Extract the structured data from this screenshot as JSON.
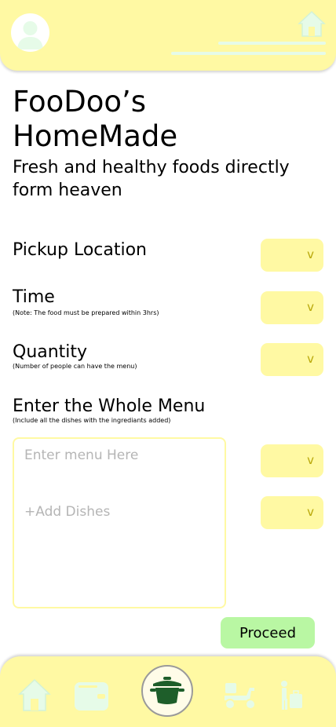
{
  "header": {
    "avatar_icon": "user-avatar-icon",
    "home_icon": "home-icon"
  },
  "title": "FooDoo’s HomeMade",
  "subtitle": "Fresh and healthy foods directly form heaven",
  "form": {
    "pickup_label": "Pickup Location",
    "time_label": "Time",
    "time_note": "(Note: The food must be prepared within 3hrs)",
    "quantity_label": "Quantity",
    "quantity_note": "(Number of people can have the menu)",
    "menu_label": "Enter the Whole Menu",
    "menu_note": "(Include all the dishes with the ingrediants added)",
    "menu_placeholder": "Enter menu Here",
    "add_dishes": "+Add Dishes",
    "dropdown_chevron": "v",
    "proceed": "Proceed"
  },
  "footer": {
    "icons": [
      "home-icon",
      "wallet-icon",
      "cooking-pot-icon",
      "delivery-scooter-icon",
      "person-luggage-icon"
    ]
  },
  "colors": {
    "accent_yellow": "#fff9a3",
    "icon_mint": "#e6fbe8",
    "proceed_green": "#b9f7a3",
    "pot_green": "#1e5e2a",
    "chevron": "#b9a80a",
    "placeholder": "#b5b5b5"
  }
}
